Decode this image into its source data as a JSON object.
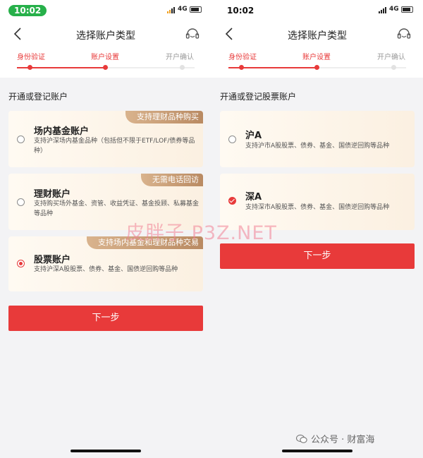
{
  "status": {
    "left_time": "10:02",
    "right_time": "10:02",
    "network": "4G"
  },
  "left": {
    "title": "选择账户类型",
    "steps": [
      "身份验证",
      "账户设置",
      "开户确认"
    ],
    "section_label": "开通或登记账户",
    "cards": [
      {
        "badge": "支持理财品种购买",
        "title": "场内基金账户",
        "desc": "支持沪深场内基金品种（包括但不限于ETF/LOF/债券等品种）",
        "selected": false
      },
      {
        "badge": "无需电话回访",
        "title": "理财账户",
        "desc": "支持购买场外基金、资管、收益凭证、基金投顾、私募基金等品种",
        "selected": false
      },
      {
        "badge": "支持场内基金和理财品种交易",
        "title": "股票账户",
        "desc": "支持沪深A股股票、债券、基金、国债逆回购等品种",
        "selected": true
      }
    ],
    "next_label": "下一步"
  },
  "right": {
    "title": "选择账户类型",
    "steps": [
      "身份验证",
      "账户设置",
      "开户确认"
    ],
    "section_label": "开通或登记股票账户",
    "cards": [
      {
        "title": "沪A",
        "desc": "支持沪市A股股票、债券、基金、国债逆回购等品种",
        "selected": false
      },
      {
        "title": "深A",
        "desc": "支持深市A股股票、债券、基金、国债逆回购等品种",
        "selected": true
      }
    ],
    "next_label": "下一步"
  },
  "watermark": "皮胖子 P3Z.NET",
  "footer_watermark": "公众号 · 财富海",
  "icons": {
    "back": "chevron-left-icon",
    "service": "headset-icon",
    "footer": "wechat-icon"
  },
  "colors": {
    "accent": "#e83a3a",
    "badge": "#c49a72",
    "card_bg": "#fcf3e8"
  }
}
